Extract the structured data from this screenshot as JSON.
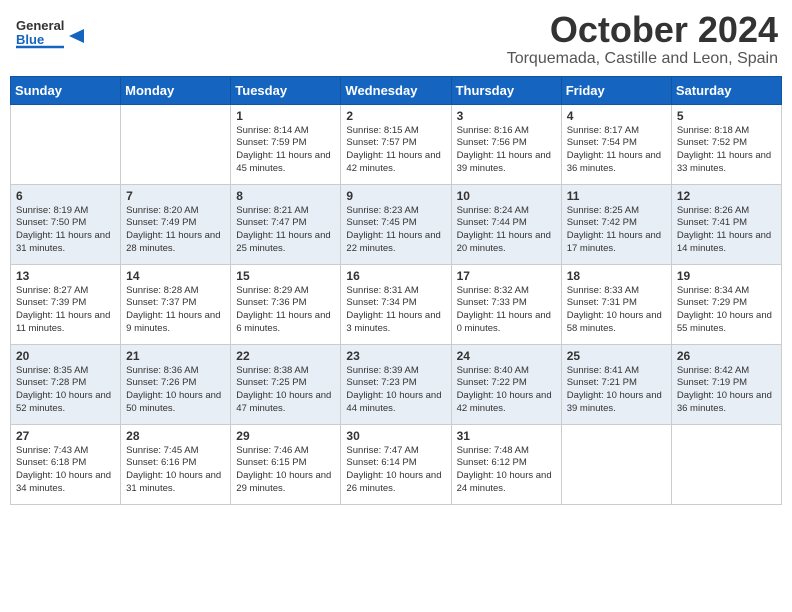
{
  "header": {
    "logo_general": "General",
    "logo_blue": "Blue",
    "month_title": "October 2024",
    "location": "Torquemada, Castille and Leon, Spain"
  },
  "days_of_week": [
    "Sunday",
    "Monday",
    "Tuesday",
    "Wednesday",
    "Thursday",
    "Friday",
    "Saturday"
  ],
  "weeks": [
    [
      {
        "day": "",
        "info": ""
      },
      {
        "day": "",
        "info": ""
      },
      {
        "day": "1",
        "info": "Sunrise: 8:14 AM\nSunset: 7:59 PM\nDaylight: 11 hours and 45 minutes."
      },
      {
        "day": "2",
        "info": "Sunrise: 8:15 AM\nSunset: 7:57 PM\nDaylight: 11 hours and 42 minutes."
      },
      {
        "day": "3",
        "info": "Sunrise: 8:16 AM\nSunset: 7:56 PM\nDaylight: 11 hours and 39 minutes."
      },
      {
        "day": "4",
        "info": "Sunrise: 8:17 AM\nSunset: 7:54 PM\nDaylight: 11 hours and 36 minutes."
      },
      {
        "day": "5",
        "info": "Sunrise: 8:18 AM\nSunset: 7:52 PM\nDaylight: 11 hours and 33 minutes."
      }
    ],
    [
      {
        "day": "6",
        "info": "Sunrise: 8:19 AM\nSunset: 7:50 PM\nDaylight: 11 hours and 31 minutes."
      },
      {
        "day": "7",
        "info": "Sunrise: 8:20 AM\nSunset: 7:49 PM\nDaylight: 11 hours and 28 minutes."
      },
      {
        "day": "8",
        "info": "Sunrise: 8:21 AM\nSunset: 7:47 PM\nDaylight: 11 hours and 25 minutes."
      },
      {
        "day": "9",
        "info": "Sunrise: 8:23 AM\nSunset: 7:45 PM\nDaylight: 11 hours and 22 minutes."
      },
      {
        "day": "10",
        "info": "Sunrise: 8:24 AM\nSunset: 7:44 PM\nDaylight: 11 hours and 20 minutes."
      },
      {
        "day": "11",
        "info": "Sunrise: 8:25 AM\nSunset: 7:42 PM\nDaylight: 11 hours and 17 minutes."
      },
      {
        "day": "12",
        "info": "Sunrise: 8:26 AM\nSunset: 7:41 PM\nDaylight: 11 hours and 14 minutes."
      }
    ],
    [
      {
        "day": "13",
        "info": "Sunrise: 8:27 AM\nSunset: 7:39 PM\nDaylight: 11 hours and 11 minutes."
      },
      {
        "day": "14",
        "info": "Sunrise: 8:28 AM\nSunset: 7:37 PM\nDaylight: 11 hours and 9 minutes."
      },
      {
        "day": "15",
        "info": "Sunrise: 8:29 AM\nSunset: 7:36 PM\nDaylight: 11 hours and 6 minutes."
      },
      {
        "day": "16",
        "info": "Sunrise: 8:31 AM\nSunset: 7:34 PM\nDaylight: 11 hours and 3 minutes."
      },
      {
        "day": "17",
        "info": "Sunrise: 8:32 AM\nSunset: 7:33 PM\nDaylight: 11 hours and 0 minutes."
      },
      {
        "day": "18",
        "info": "Sunrise: 8:33 AM\nSunset: 7:31 PM\nDaylight: 10 hours and 58 minutes."
      },
      {
        "day": "19",
        "info": "Sunrise: 8:34 AM\nSunset: 7:29 PM\nDaylight: 10 hours and 55 minutes."
      }
    ],
    [
      {
        "day": "20",
        "info": "Sunrise: 8:35 AM\nSunset: 7:28 PM\nDaylight: 10 hours and 52 minutes."
      },
      {
        "day": "21",
        "info": "Sunrise: 8:36 AM\nSunset: 7:26 PM\nDaylight: 10 hours and 50 minutes."
      },
      {
        "day": "22",
        "info": "Sunrise: 8:38 AM\nSunset: 7:25 PM\nDaylight: 10 hours and 47 minutes."
      },
      {
        "day": "23",
        "info": "Sunrise: 8:39 AM\nSunset: 7:23 PM\nDaylight: 10 hours and 44 minutes."
      },
      {
        "day": "24",
        "info": "Sunrise: 8:40 AM\nSunset: 7:22 PM\nDaylight: 10 hours and 42 minutes."
      },
      {
        "day": "25",
        "info": "Sunrise: 8:41 AM\nSunset: 7:21 PM\nDaylight: 10 hours and 39 minutes."
      },
      {
        "day": "26",
        "info": "Sunrise: 8:42 AM\nSunset: 7:19 PM\nDaylight: 10 hours and 36 minutes."
      }
    ],
    [
      {
        "day": "27",
        "info": "Sunrise: 7:43 AM\nSunset: 6:18 PM\nDaylight: 10 hours and 34 minutes."
      },
      {
        "day": "28",
        "info": "Sunrise: 7:45 AM\nSunset: 6:16 PM\nDaylight: 10 hours and 31 minutes."
      },
      {
        "day": "29",
        "info": "Sunrise: 7:46 AM\nSunset: 6:15 PM\nDaylight: 10 hours and 29 minutes."
      },
      {
        "day": "30",
        "info": "Sunrise: 7:47 AM\nSunset: 6:14 PM\nDaylight: 10 hours and 26 minutes."
      },
      {
        "day": "31",
        "info": "Sunrise: 7:48 AM\nSunset: 6:12 PM\nDaylight: 10 hours and 24 minutes."
      },
      {
        "day": "",
        "info": ""
      },
      {
        "day": "",
        "info": ""
      }
    ]
  ]
}
